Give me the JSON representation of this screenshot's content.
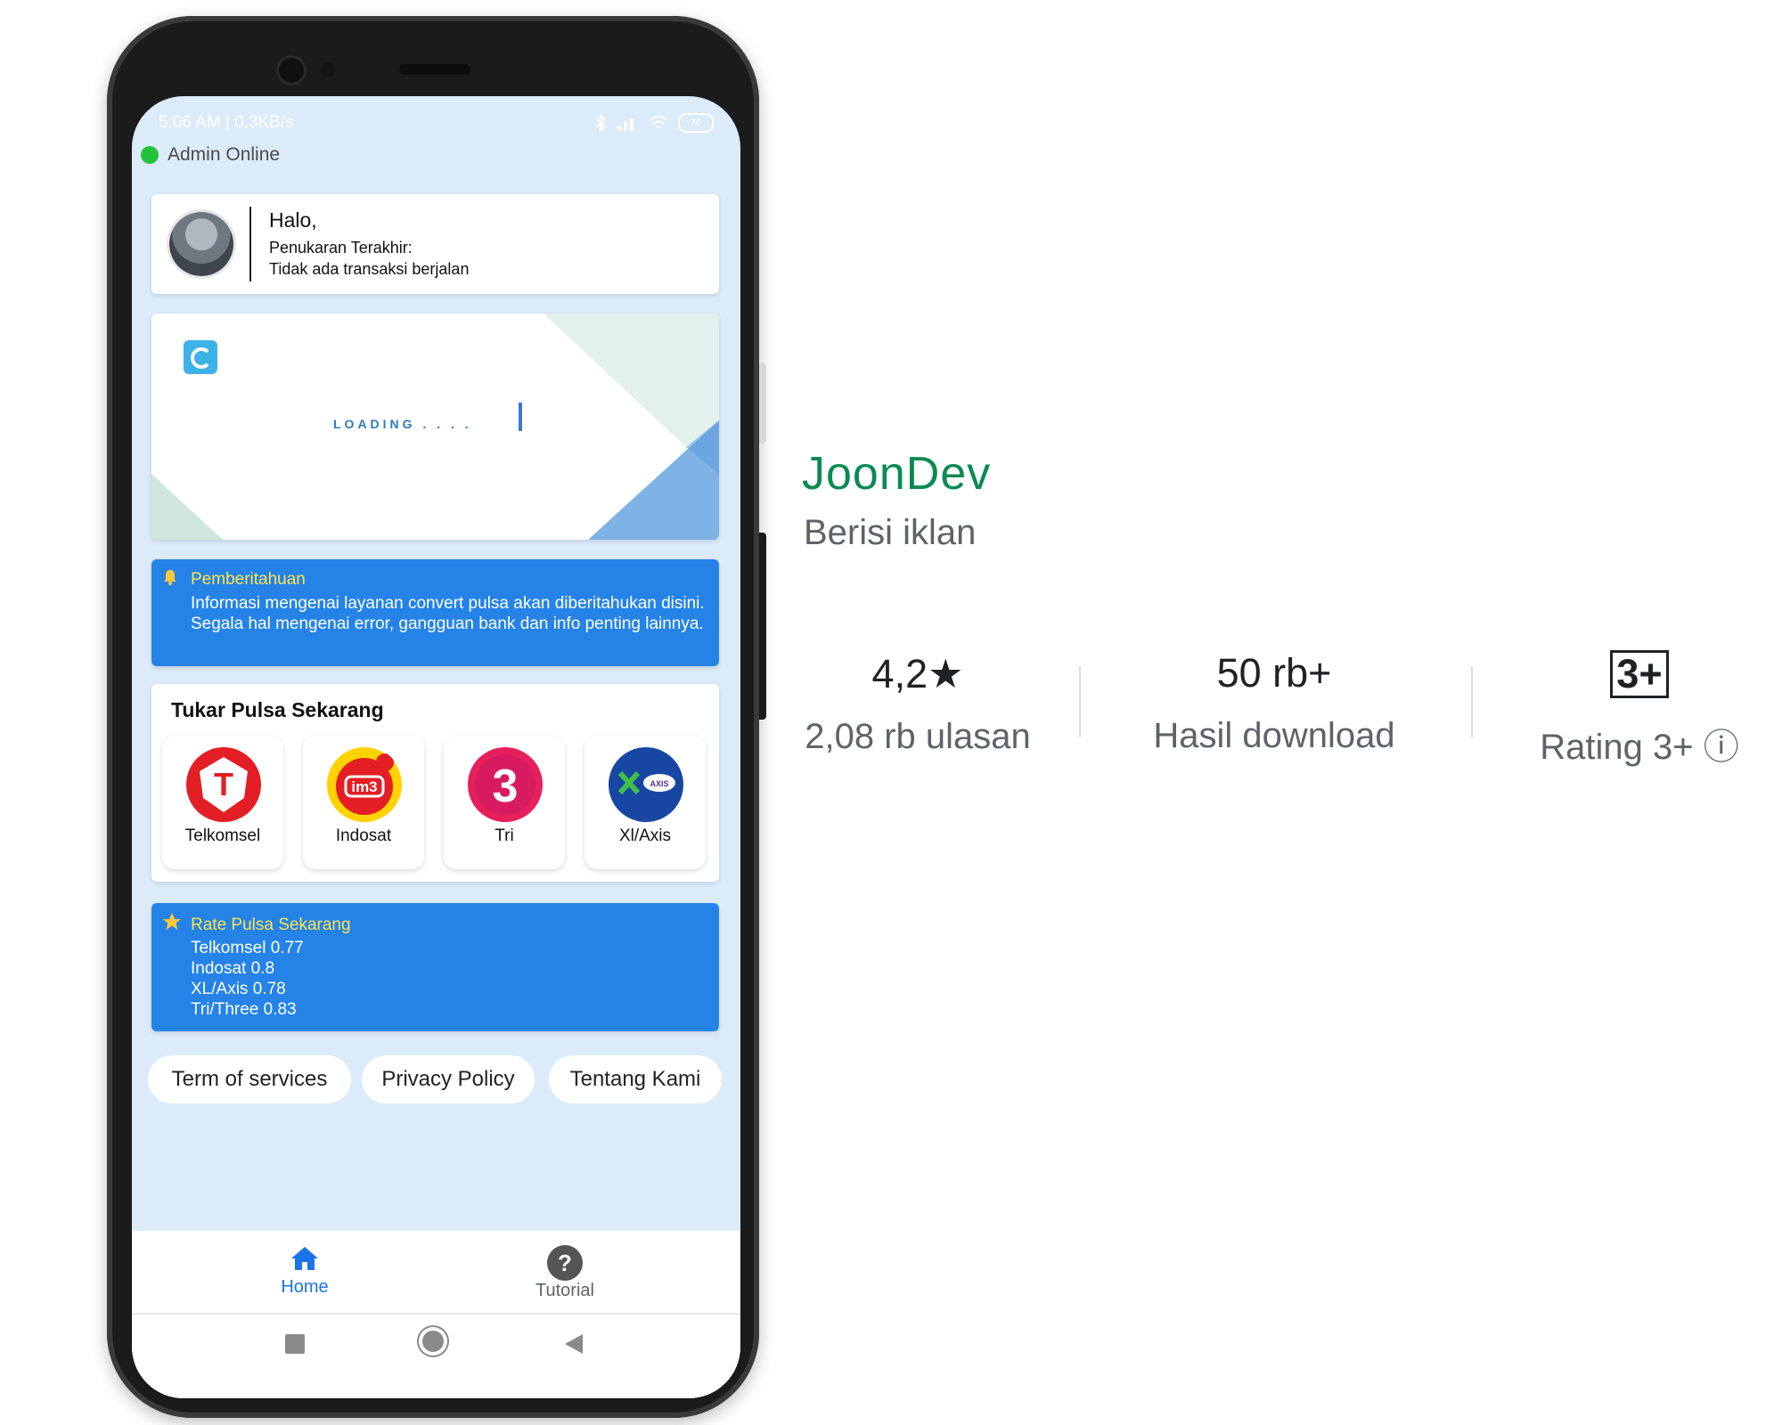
{
  "statusbar": {
    "left": "5:06 AM | 0,3KB/s",
    "battery": "76"
  },
  "admin_status": "Admin Online",
  "greeting": {
    "title": "Halo,",
    "last_label": "Penukaran Terakhir:",
    "last_value": "Tidak ada transaksi berjalan"
  },
  "banner": {
    "loading": "LOADING . . . ."
  },
  "notice": {
    "title": "Pemberitahuan",
    "text": "Informasi mengenai layanan convert pulsa akan diberitahukan disini. Segala hal mengenai error, gangguan bank dan info penting lainnya."
  },
  "tukar": {
    "title": "Tukar Pulsa Sekarang",
    "operators": [
      {
        "name": "Telkomsel",
        "logo_text": "T",
        "color": "#e31e24"
      },
      {
        "name": "Indosat",
        "logo_text": "im3",
        "color": "#ffd200"
      },
      {
        "name": "Tri",
        "logo_text": "3",
        "color": "#e6205b"
      },
      {
        "name": "Xl/Axis",
        "logo_text": "AXIS",
        "color": "#1846a3"
      }
    ]
  },
  "rate": {
    "title": "Rate Pulsa Sekarang",
    "lines": [
      "Telkomsel 0.77",
      "Indosat 0.8",
      "XL/Axis 0.78",
      "Tri/Three 0.83"
    ]
  },
  "links": {
    "terms": "Term of services",
    "privacy": "Privacy Policy",
    "about": "Tentang Kami"
  },
  "nav": {
    "home": "Home",
    "tutorial": "Tutorial",
    "tutorial_glyph": "?"
  },
  "store": {
    "developer": "JoonDev",
    "ads": "Berisi iklan",
    "rating_value": "4,2",
    "rating_star": "★",
    "reviews": "2,08 rb ulasan",
    "downloads": "50 rb+",
    "downloads_label": "Hasil download",
    "content_rating_badge": "3+",
    "content_rating_label": "Rating 3+",
    "info_glyph": "ⓘ"
  },
  "colors": {
    "accent_blue": "#2583e8",
    "highlight_yellow": "#ffe24a",
    "developer_green": "#0b8a52"
  }
}
